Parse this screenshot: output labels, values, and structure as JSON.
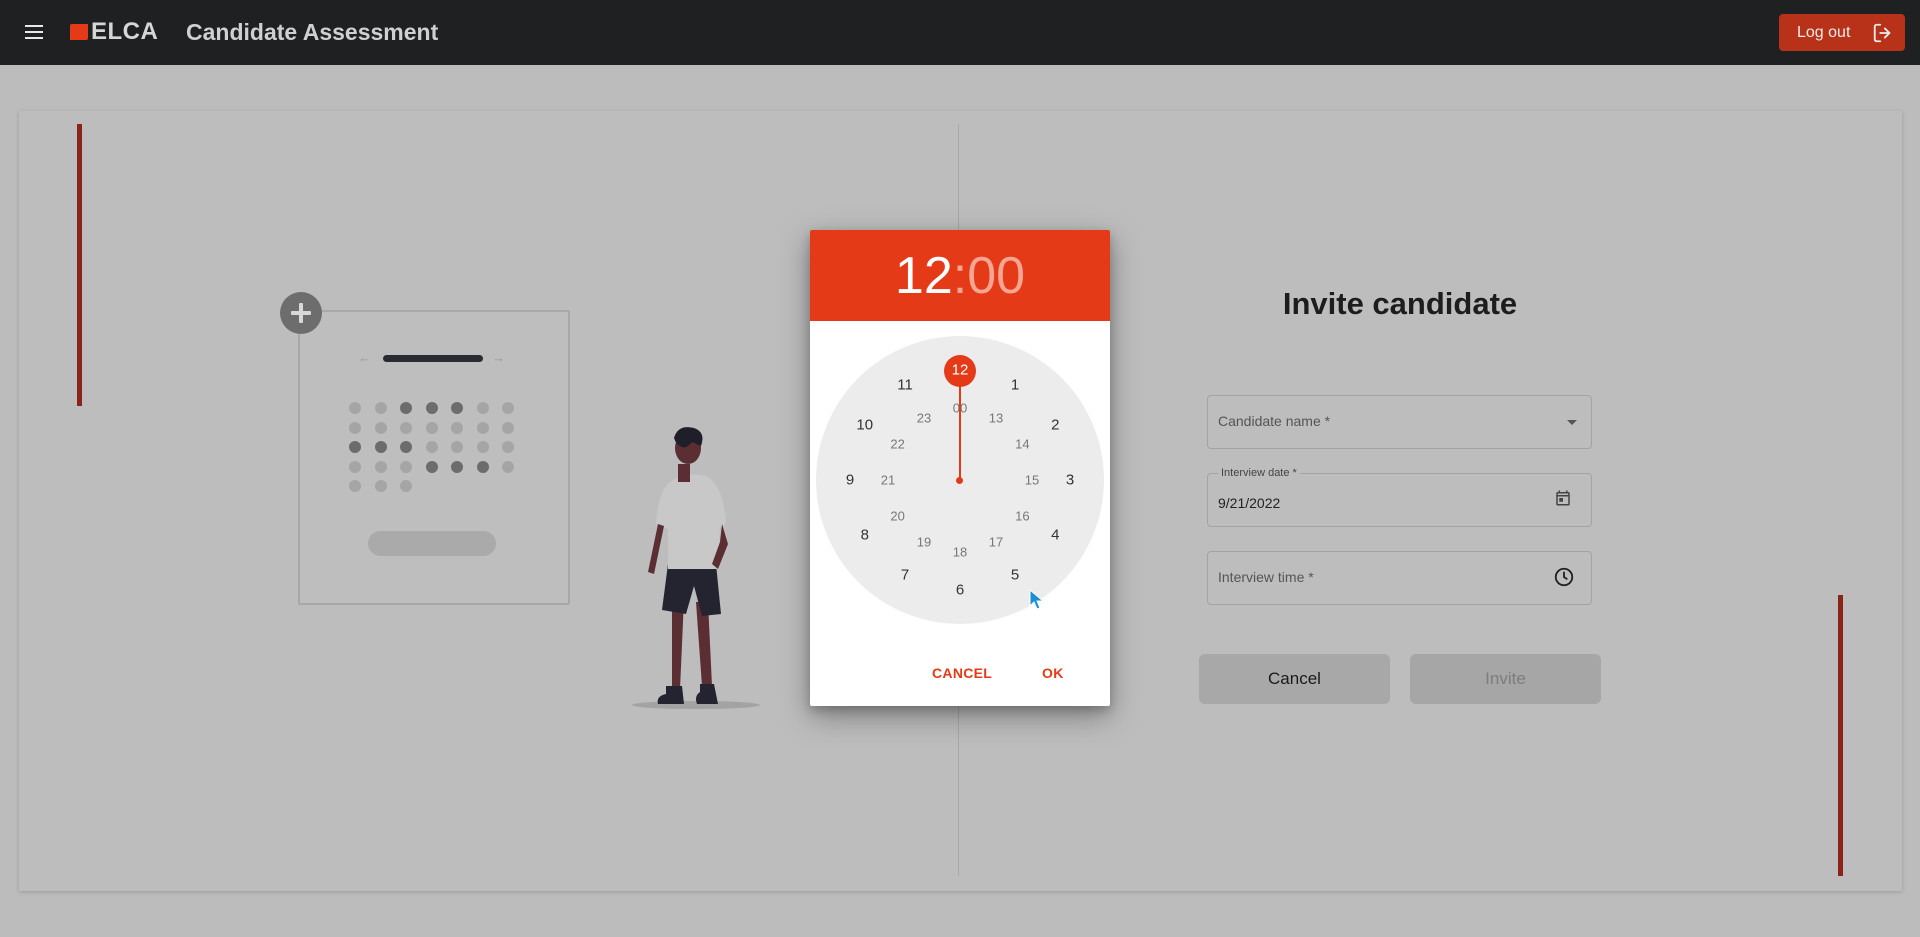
{
  "header": {
    "logo_text": "ELCA",
    "app_title": "Candidate Assessment",
    "logout_label": "Log out"
  },
  "form": {
    "title": "Invite candidate",
    "candidate_name_placeholder": "Candidate name *",
    "interview_date_label": "Interview date *",
    "interview_date_value": "9/21/2022",
    "interview_time_placeholder": "Interview time *",
    "cancel_label": "Cancel",
    "invite_label": "Invite"
  },
  "time_picker": {
    "hours": "12",
    "separator": ":",
    "minutes": "00",
    "selected_hour": "12",
    "outer_numbers": [
      "12",
      "1",
      "2",
      "3",
      "4",
      "5",
      "6",
      "7",
      "8",
      "9",
      "10",
      "11"
    ],
    "inner_numbers": [
      "00",
      "13",
      "14",
      "15",
      "16",
      "17",
      "18",
      "19",
      "20",
      "21",
      "22",
      "23"
    ],
    "cancel_label": "CANCEL",
    "ok_label": "OK"
  },
  "colors": {
    "accent": "#e53a17",
    "topbar": "#1f2022",
    "logout_button": "#b8321a"
  },
  "icons": {
    "menu": "menu-icon",
    "logout": "logout-icon",
    "calendar": "calendar-icon",
    "clock": "clock-icon",
    "dropdown": "chevron-down-icon"
  }
}
